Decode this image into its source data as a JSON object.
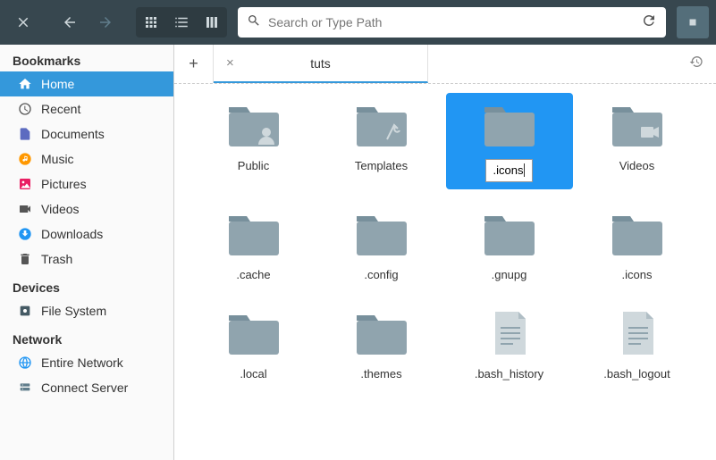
{
  "toolbar": {
    "search_placeholder": "Search or Type Path"
  },
  "sidebar": {
    "sections": {
      "bookmarks": "Bookmarks",
      "devices": "Devices",
      "network": "Network"
    },
    "items": [
      {
        "label": "Home",
        "icon": "home"
      },
      {
        "label": "Recent",
        "icon": "recent"
      },
      {
        "label": "Documents",
        "icon": "documents"
      },
      {
        "label": "Music",
        "icon": "music"
      },
      {
        "label": "Pictures",
        "icon": "pictures"
      },
      {
        "label": "Videos",
        "icon": "videos"
      },
      {
        "label": "Downloads",
        "icon": "downloads"
      },
      {
        "label": "Trash",
        "icon": "trash"
      },
      {
        "label": "File System",
        "icon": "filesystem"
      },
      {
        "label": "Entire Network",
        "icon": "network"
      },
      {
        "label": "Connect Server",
        "icon": "server"
      }
    ]
  },
  "tabs": [
    {
      "label": "tuts"
    }
  ],
  "files": [
    {
      "name": "Public",
      "type": "folder-user"
    },
    {
      "name": "Templates",
      "type": "folder-templates"
    },
    {
      "name": ".icons",
      "type": "folder",
      "editing": true
    },
    {
      "name": "Videos",
      "type": "folder-videos"
    },
    {
      "name": ".cache",
      "type": "folder"
    },
    {
      "name": ".config",
      "type": "folder"
    },
    {
      "name": ".gnupg",
      "type": "folder"
    },
    {
      "name": ".icons",
      "type": "folder"
    },
    {
      "name": ".local",
      "type": "folder"
    },
    {
      "name": ".themes",
      "type": "folder"
    },
    {
      "name": ".bash_history",
      "type": "file"
    },
    {
      "name": ".bash_logout",
      "type": "file"
    }
  ]
}
